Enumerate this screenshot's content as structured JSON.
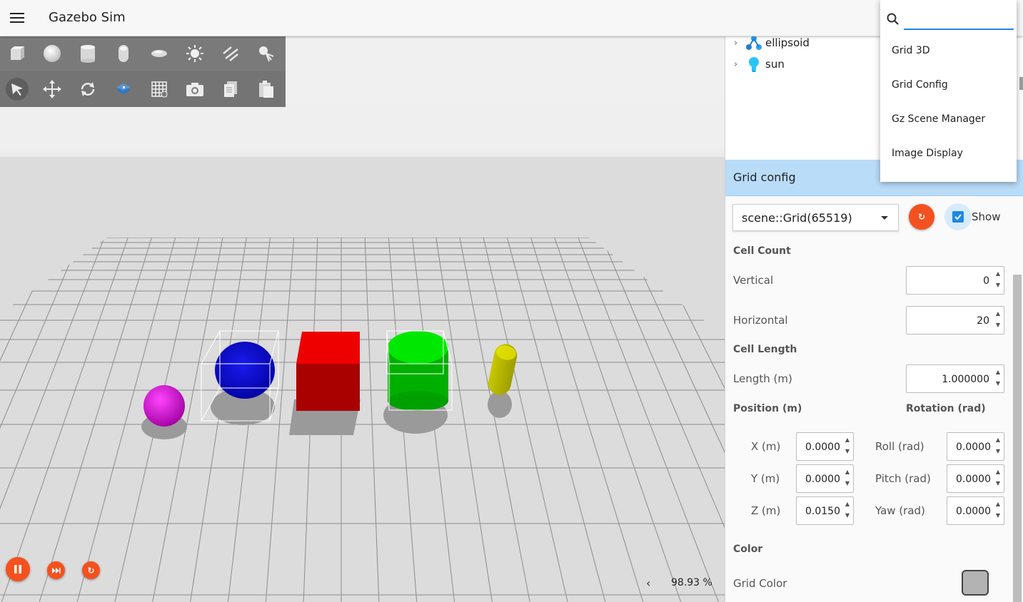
{
  "app": {
    "title": "Gazebo Sim"
  },
  "entity_tree": {
    "items": [
      {
        "label": "ellipsoid",
        "icon": "model-icon"
      },
      {
        "label": "sun",
        "icon": "light-bulb-icon"
      }
    ]
  },
  "plugin_menu": {
    "search_value": "",
    "items": [
      "Grid 3D",
      "Grid Config",
      "Gz Scene Manager",
      "Image Display"
    ]
  },
  "grid_config": {
    "title": "Grid config",
    "selected_grid": "scene::Grid(65519)",
    "show_label": "Show",
    "show_checked": true,
    "cell_count_label": "Cell Count",
    "vertical_label": "Vertical",
    "vertical_value": "0",
    "horizontal_label": "Horizontal",
    "horizontal_value": "20",
    "cell_length_label": "Cell Length",
    "length_label": "Length (m)",
    "length_value": "1.000000",
    "position_label": "Position (m)",
    "rotation_label": "Rotation (rad)",
    "x_label": "X (m)",
    "x_value": "0.0000",
    "y_label": "Y (m)",
    "y_value": "0.0000",
    "z_label": "Z (m)",
    "z_value": "0.0150",
    "roll_label": "Roll (rad)",
    "roll_value": "0.0000",
    "pitch_label": "Pitch (rad)",
    "pitch_value": "0.0000",
    "yaw_label": "Yaw (rad)",
    "yaw_value": "0.0000",
    "color_label": "Color",
    "grid_color_label": "Grid Color",
    "grid_color": "#b3b3b3"
  },
  "toolbar": {
    "row1": [
      "box-shape-icon",
      "sphere-shape-icon",
      "cylinder-shape-icon",
      "capsule-shape-icon",
      "ellipsoid-shape-icon",
      "point-light-icon",
      "directional-light-icon",
      "spot-light-icon"
    ],
    "row2": [
      "select-tool-icon",
      "translate-tool-icon",
      "rotate-tool-icon",
      "transform-control-icon",
      "snap-grid-icon",
      "screenshot-icon",
      "copy-icon",
      "paste-icon"
    ]
  },
  "playback": {
    "real_time_factor": "98.93 %"
  },
  "scene_objects": [
    {
      "name": "sphere",
      "color": "#cc00cc"
    },
    {
      "name": "ellipsoid",
      "color": "#0000cc"
    },
    {
      "name": "box",
      "color": "#ee0000"
    },
    {
      "name": "cylinder",
      "color": "#00cc00"
    },
    {
      "name": "capsule",
      "color": "#bbbb00"
    }
  ],
  "colors": {
    "accent": "#f4511e",
    "header_blue": "#b9dcf9",
    "check_blue": "#1e88e5"
  }
}
